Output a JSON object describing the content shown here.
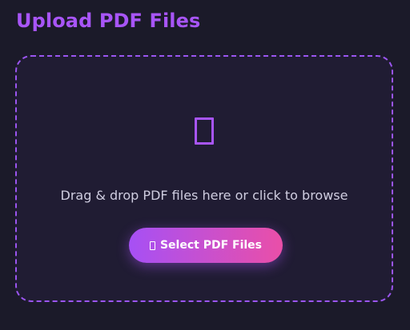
{
  "header": {
    "title": "Upload PDF Files"
  },
  "drop_zone": {
    "icon": "file-glyph-icon",
    "instruction": "Drag & drop PDF files here or click to browse",
    "select_button": {
      "icon": "file-glyph-icon",
      "label": "Select PDF Files"
    }
  },
  "colors": {
    "background": "#1b1a29",
    "accent": "#a855f7",
    "button_gradient_start": "#a650f5",
    "button_gradient_end": "#ea4fa8"
  }
}
